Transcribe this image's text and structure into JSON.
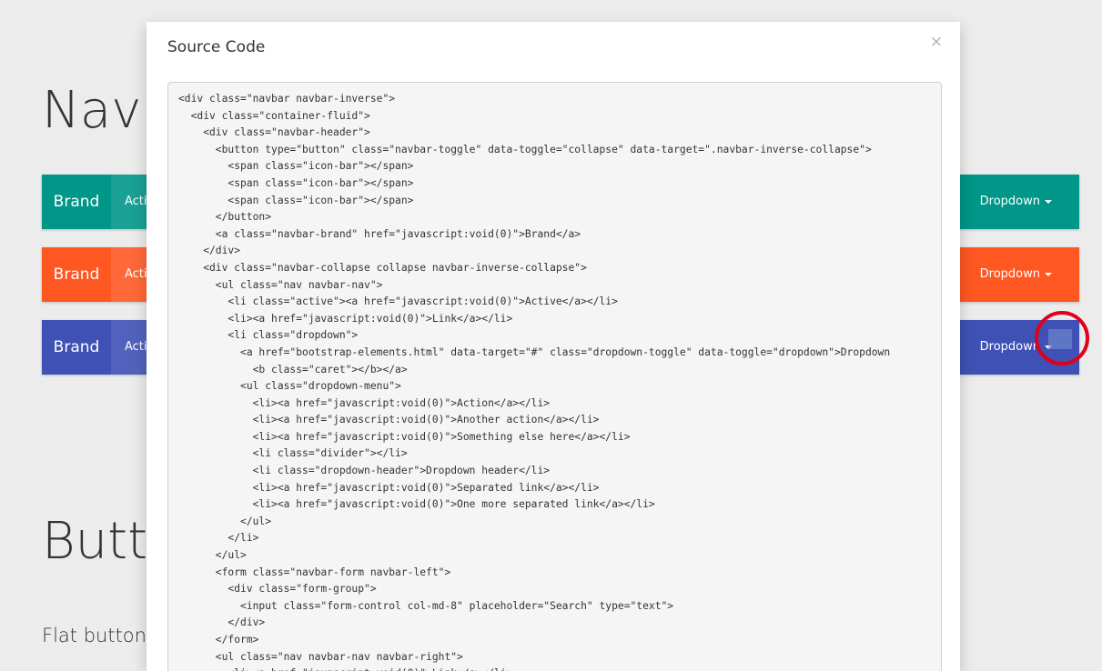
{
  "background": {
    "heading_navbars": "Navb",
    "heading_buttons": "Butto",
    "subheading": "Flat buttons",
    "navbars": [
      {
        "brand": "Brand",
        "active": "Acti",
        "dropdown": "Dropdown",
        "color": "#009688"
      },
      {
        "brand": "Brand",
        "active": "Acti",
        "dropdown": "Dropdown",
        "color": "#ff5722"
      },
      {
        "brand": "Brand",
        "active": "Acti",
        "dropdown": "Dropdown",
        "color": "#3f51b5"
      }
    ]
  },
  "modal": {
    "title": "Source Code",
    "close_label": "×",
    "code": "<div class=\"navbar navbar-inverse\">\n  <div class=\"container-fluid\">\n    <div class=\"navbar-header\">\n      <button type=\"button\" class=\"navbar-toggle\" data-toggle=\"collapse\" data-target=\".navbar-inverse-collapse\">\n        <span class=\"icon-bar\"></span>\n        <span class=\"icon-bar\"></span>\n        <span class=\"icon-bar\"></span>\n      </button>\n      <a class=\"navbar-brand\" href=\"javascript:void(0)\">Brand</a>\n    </div>\n    <div class=\"navbar-collapse collapse navbar-inverse-collapse\">\n      <ul class=\"nav navbar-nav\">\n        <li class=\"active\"><a href=\"javascript:void(0)\">Active</a></li>\n        <li><a href=\"javascript:void(0)\">Link</a></li>\n        <li class=\"dropdown\">\n          <a href=\"bootstrap-elements.html\" data-target=\"#\" class=\"dropdown-toggle\" data-toggle=\"dropdown\">Dropdown\n            <b class=\"caret\"></b></a>\n          <ul class=\"dropdown-menu\">\n            <li><a href=\"javascript:void(0)\">Action</a></li>\n            <li><a href=\"javascript:void(0)\">Another action</a></li>\n            <li><a href=\"javascript:void(0)\">Something else here</a></li>\n            <li class=\"divider\"></li>\n            <li class=\"dropdown-header\">Dropdown header</li>\n            <li><a href=\"javascript:void(0)\">Separated link</a></li>\n            <li><a href=\"javascript:void(0)\">One more separated link</a></li>\n          </ul>\n        </li>\n      </ul>\n      <form class=\"navbar-form navbar-left\">\n        <div class=\"form-group\">\n          <input class=\"form-control col-md-8\" placeholder=\"Search\" type=\"text\">\n        </div>\n      </form>\n      <ul class=\"nav navbar-nav navbar-right\">\n        <li><a href=\"javascript:void(0)\">Link</a></li>"
  },
  "colors": {
    "page_background": "#ececec",
    "teal": "#009688",
    "orange": "#ff5722",
    "indigo": "#3f51b5",
    "annotation_ring": "#e0001a"
  }
}
